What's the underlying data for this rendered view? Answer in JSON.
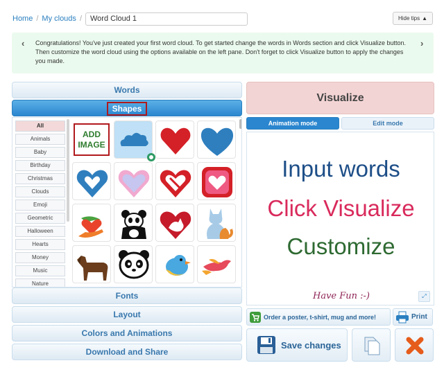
{
  "breadcrumb": {
    "home": "Home",
    "my_clouds": "My clouds",
    "cloud_name": "Word Cloud 1"
  },
  "hide_tips": {
    "label": "Hide tips",
    "icon": "chevron-up-icon"
  },
  "tip": {
    "text": "Congratulations! You've just created your first word cloud. To get started change the words in Words section and click Visualize button. Then customize the word cloud using the options available on the left pane. Don't forget to click Visualize button to apply the changes you made."
  },
  "accordion": {
    "words": "Words",
    "shapes": "Shapes",
    "fonts": "Fonts",
    "layout": "Layout",
    "colors": "Colors and Animations",
    "download": "Download and Share"
  },
  "shape_categories": [
    "All",
    "Animals",
    "Baby",
    "Birthday",
    "Christmas",
    "Clouds",
    "Emoji",
    "Geometric",
    "Halloween",
    "Hearts",
    "Money",
    "Music",
    "Nature"
  ],
  "selected_category": "All",
  "shapes": {
    "add_image": "ADD IMAGE",
    "tiles": [
      "cloud",
      "heart",
      "heart",
      "heart",
      "heart",
      "heart",
      "heart",
      "hand-heart",
      "panda",
      "heart",
      "cat",
      "dog",
      "panda",
      "bird",
      "bird"
    ],
    "selected": "cloud"
  },
  "right": {
    "visualize": "Visualize",
    "animation_mode": "Animation mode",
    "edit_mode": "Edit mode"
  },
  "canvas": {
    "words": [
      "Input words",
      "Click Visualize",
      "Customize",
      "Have Fun :-)"
    ],
    "colors": [
      "#1d4e87",
      "#d92a5c",
      "#2e6a32",
      "#8e2456"
    ]
  },
  "actions": {
    "order": "Order a poster, t-shirt, mug and more!",
    "print": "Print",
    "save": "Save changes"
  },
  "colors": {
    "accent": "#2a7fc0",
    "tip_bg": "#ebfaee",
    "visualize_bg": "#f3d4d4",
    "delete": "#e65c1b",
    "heart_red": "#d42027",
    "heart_blue": "#2f7fbe"
  }
}
